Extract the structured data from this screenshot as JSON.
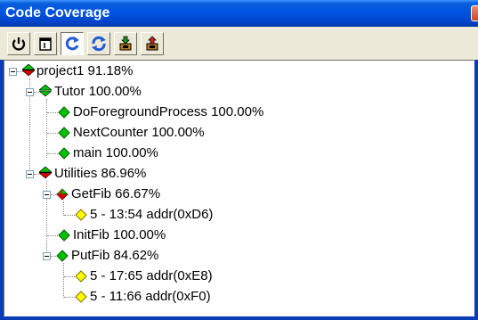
{
  "window": {
    "title": "Code Coverage"
  },
  "toolbar": {
    "buttons": [
      {
        "name": "power-icon",
        "pressed": false
      },
      {
        "name": "page-icon",
        "pressed": false
      },
      {
        "name": "refresh-icon",
        "pressed": true
      },
      {
        "name": "sync-icon",
        "pressed": false
      },
      {
        "name": "download-icon",
        "pressed": false
      },
      {
        "name": "upload-icon",
        "pressed": false
      }
    ]
  },
  "tree": {
    "nodes": [
      {
        "label": "project1 91.18%",
        "icon": "green-red-split-icon",
        "expanded": true
      },
      {
        "label": "Tutor 100.00%",
        "icon": "green-red-split-icon",
        "expanded": true
      },
      {
        "label": "DoForegroundProcess 100.00%",
        "icon": "green-diamond-icon"
      },
      {
        "label": "NextCounter 100.00%",
        "icon": "green-diamond-icon"
      },
      {
        "label": "main 100.00%",
        "icon": "green-diamond-icon"
      },
      {
        "label": "Utilities 86.96%",
        "icon": "green-red-split-icon",
        "expanded": true
      },
      {
        "label": "GetFib 66.67%",
        "icon": "red-green-diamond-icon",
        "expanded": true
      },
      {
        "label": "5 - 13:54 addr(0xD6)",
        "icon": "yellow-diamond-icon"
      },
      {
        "label": "InitFib 100.00%",
        "icon": "green-diamond-icon"
      },
      {
        "label": "PutFib 84.62%",
        "icon": "green-diamond-icon",
        "expanded": true
      },
      {
        "label": "5 - 17:65 addr(0xE8)",
        "icon": "yellow-diamond-icon"
      },
      {
        "label": "5 - 11:66 addr(0xF0)",
        "icon": "yellow-diamond-icon"
      }
    ]
  },
  "colors": {
    "titlebar": "#0054e3",
    "green": "#00c000",
    "red": "#e00000",
    "yellow": "#ffff00",
    "blue_icon": "#1f5bd6"
  }
}
